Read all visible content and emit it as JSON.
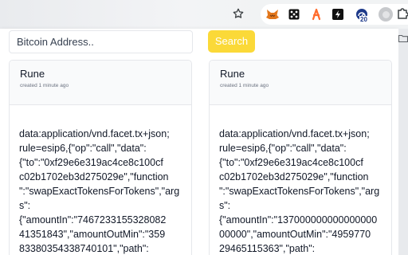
{
  "search": {
    "placeholder": "Bitcoin Address..",
    "button_label": "Search"
  },
  "toolbar": {
    "badge_count": "20",
    "extensions": [
      "fox-icon",
      "dice-icon",
      "runner-icon",
      "bolt-icon",
      "gauge-icon",
      "avatar-icon",
      "puzzle-icon"
    ]
  },
  "cards": [
    {
      "title": "Rune",
      "meta": "created 1 minute ago",
      "lines": [
        "data:application/vnd.facet.tx+json;",
        "rule=esip6,{\"op\":\"call\",\"data\":",
        "{\"to\":\"0xf29e6e319ac4ce8c100cf",
        "c02b1702eb3d275029e\",\"function",
        "\":\"swapExactTokensForTokens\",\"arg",
        "s\":",
        "{\"amountIn\":\"7467233155328082",
        "41351843\",\"amountOutMin\":\"359",
        "83380354338740101\",\"path\":"
      ]
    },
    {
      "title": "Rune",
      "meta": "created 1 minute ago",
      "lines": [
        "data:application/vnd.facet.tx+json;",
        "rule=esip6,{\"op\":\"call\",\"data\":",
        "{\"to\":\"0xf29e6e319ac4ce8c100cf",
        "c02b1702eb3d275029e\",\"function",
        "\":\"swapExactTokensForTokens\",\"arg",
        "s\":",
        "{\"amountIn\":\"137000000000000000",
        "00000\",\"amountOutMin\":\"4959770",
        "29465115363\",\"path\":"
      ]
    }
  ],
  "colors": {
    "accent": "#fbd938",
    "card_border": "#e5e7eb",
    "card_header_bg": "#f9fafb"
  }
}
